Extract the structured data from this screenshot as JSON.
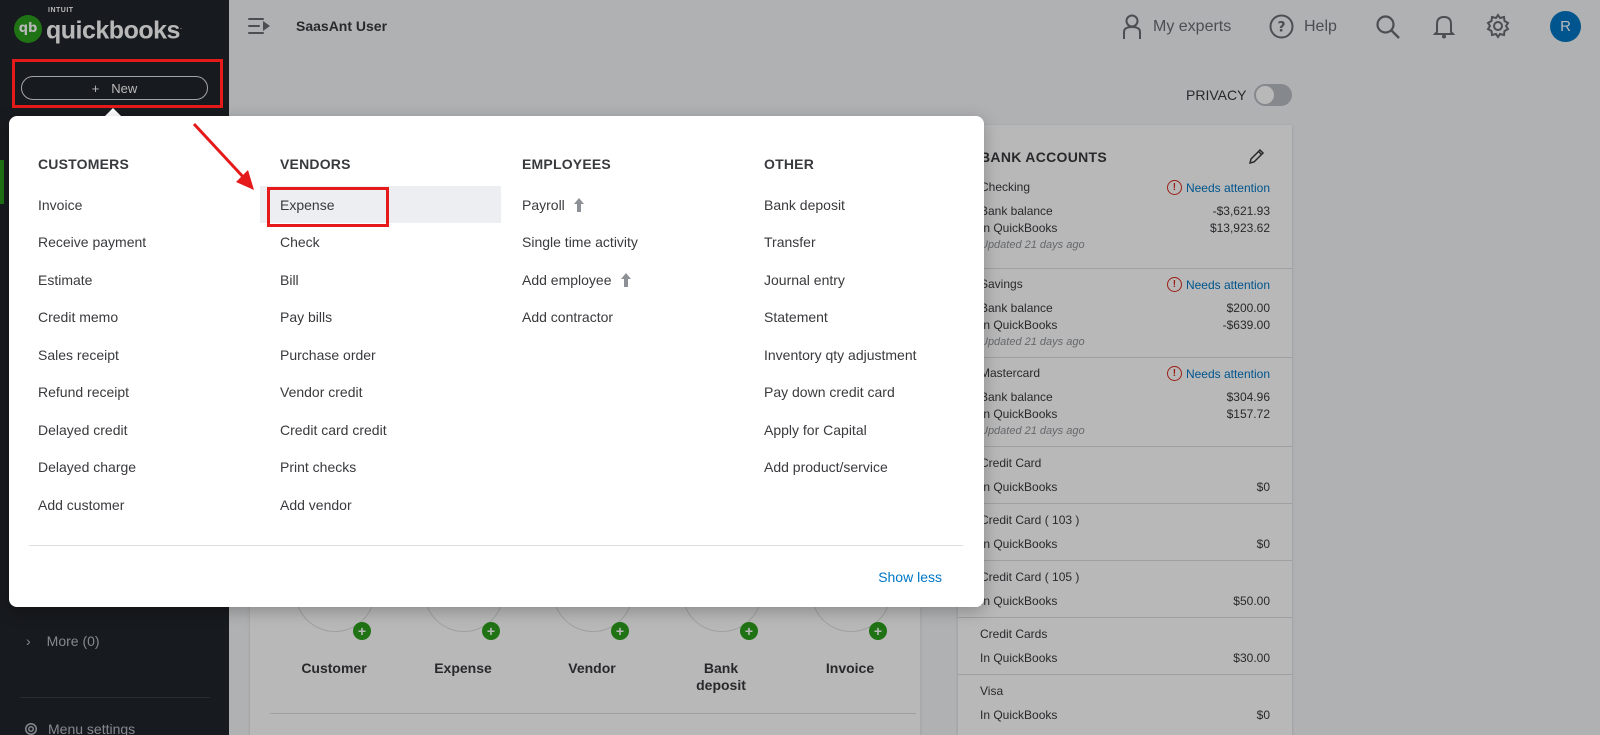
{
  "app": {
    "logo_small": "INTUIT",
    "logo_name": "quickbooks",
    "logo_mark": "qb",
    "new_button_label": "New",
    "new_button_icon": "plus-icon"
  },
  "sidebar": {
    "more_label": "More (0)",
    "settings_label": "Menu settings"
  },
  "topbar": {
    "company_name": "SaasAnt User",
    "experts_label": "My experts",
    "help_label": "Help",
    "avatar_initial": "R"
  },
  "privacy": {
    "label": "PRIVACY",
    "enabled": false
  },
  "menu": {
    "columns": [
      {
        "heading": "CUSTOMERS",
        "items": [
          "Invoice",
          "Receive payment",
          "Estimate",
          "Credit memo",
          "Sales receipt",
          "Refund receipt",
          "Delayed credit",
          "Delayed charge",
          "Add customer"
        ]
      },
      {
        "heading": "VENDORS",
        "items": [
          "Expense",
          "Check",
          "Bill",
          "Pay bills",
          "Purchase order",
          "Vendor credit",
          "Credit card credit",
          "Print checks",
          "Add vendor"
        ]
      },
      {
        "heading": "EMPLOYEES",
        "items": [
          "Payroll",
          "Single time activity",
          "Add employee",
          "Add contractor"
        ]
      },
      {
        "heading": "OTHER",
        "items": [
          "Bank deposit",
          "Transfer",
          "Journal entry",
          "Statement",
          "Inventory qty adjustment",
          "Pay down credit card",
          "Apply for Capital",
          "Add product/service"
        ]
      }
    ],
    "show_less_label": "Show less",
    "selected_item": "Expense"
  },
  "bank_accounts": {
    "title": "BANK ACCOUNTS",
    "accounts": [
      {
        "name": "Checking",
        "status": "Needs attention",
        "bank_label": "Bank balance",
        "bank_value": "-$3,621.93",
        "qb_label": "In QuickBooks",
        "qb_value": "$13,923.62",
        "updated": "Updated 21 days ago"
      },
      {
        "name": "Savings",
        "status": "Needs attention",
        "bank_label": "Bank balance",
        "bank_value": "$200.00",
        "qb_label": "In QuickBooks",
        "qb_value": "-$639.00",
        "updated": "Updated 21 days ago"
      },
      {
        "name": "Mastercard",
        "status": "Needs attention",
        "bank_label": "Bank balance",
        "bank_value": "$304.96",
        "qb_label": "In QuickBooks",
        "qb_value": "$157.72",
        "updated": "Updated 21 days ago"
      },
      {
        "name": "Credit Card",
        "qb_label": "In QuickBooks",
        "qb_value": "$0"
      },
      {
        "name": "Credit Card ( 103 )",
        "qb_label": "In QuickBooks",
        "qb_value": "$0"
      },
      {
        "name": "Credit Card ( 105 )",
        "qb_label": "In QuickBooks",
        "qb_value": "$50.00"
      },
      {
        "name": "Credit Cards",
        "qb_label": "In QuickBooks",
        "qb_value": "$30.00"
      },
      {
        "name": "Visa",
        "qb_label": "In QuickBooks",
        "qb_value": "$0"
      }
    ]
  },
  "shortcuts": [
    {
      "label": "Customer",
      "icon": "customer-icon"
    },
    {
      "label": "Expense",
      "icon": "expense-icon"
    },
    {
      "label": "Vendor",
      "icon": "vendor-icon"
    },
    {
      "label": "Bank deposit",
      "icon": "bank-deposit-icon"
    },
    {
      "label": "Invoice",
      "icon": "invoice-icon"
    }
  ],
  "colors": {
    "sidebar_bg": "#21252a",
    "brand_green": "#2ca01c",
    "link_blue": "#0077c5",
    "annotation_red": "#e51a1a",
    "alert_red": "#d52b1e"
  }
}
